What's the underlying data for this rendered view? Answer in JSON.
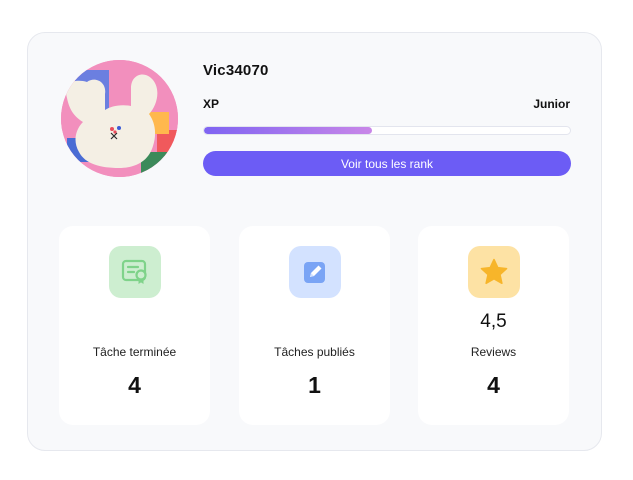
{
  "profile": {
    "username": "Vic34070",
    "xp_label": "XP",
    "rank": "Junior",
    "xp_progress_percent": 46,
    "view_ranks_label": "Voir tous les rank"
  },
  "stats": [
    {
      "icon": "certificate-icon",
      "score": "",
      "label": "Tâche terminée",
      "value": "4",
      "icon_bg": "#cdeed0",
      "icon_color": "#7fd38a"
    },
    {
      "icon": "edit-icon",
      "score": "",
      "label": "Tâches publiés",
      "value": "1",
      "icon_bg": "#d3e2ff",
      "icon_color": "#7aa4f5"
    },
    {
      "icon": "star-icon",
      "score": "4,5",
      "label": "Reviews",
      "value": "4",
      "icon_bg": "#fde2a4",
      "icon_color": "#f7b52a"
    }
  ],
  "colors": {
    "accent": "#6c5cf5",
    "avatar_bg": "#f28fbd"
  }
}
